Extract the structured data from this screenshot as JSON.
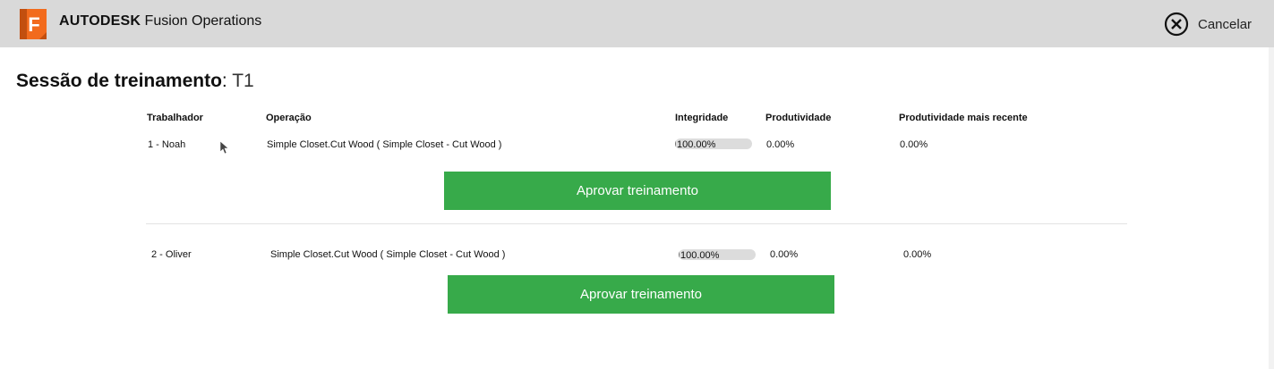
{
  "header": {
    "brand_bold": "AUTODESK",
    "brand_rest": " Fusion Operations",
    "logo_letter": "F",
    "cancel_label": "Cancelar",
    "logo_color": "#f26b1d"
  },
  "page": {
    "title_label": "Sessão de treinamento",
    "title_colon": ":",
    "title_value": " T1"
  },
  "columns": {
    "worker": "Trabalhador",
    "operation": "Operação",
    "integrity": "Integridade",
    "productivity": "Produtividade",
    "recent_productivity": "Produtividade mais recente"
  },
  "rows": [
    {
      "worker": "1 - Noah",
      "operation": "Simple Closet.Cut Wood ( Simple Closet - Cut Wood )",
      "integrity_text": "100.00%",
      "integrity_value": 1.0,
      "productivity": "0.00%",
      "recent_productivity": "0.00%",
      "approve_label": "Aprovar treinamento"
    },
    {
      "worker": "2 - Oliver",
      "operation": "Simple Closet.Cut Wood ( Simple Closet - Cut Wood )",
      "integrity_text": "100.00%",
      "integrity_value": 1.0,
      "productivity": "0.00%",
      "recent_productivity": "0.00%",
      "approve_label": "Aprovar treinamento"
    }
  ],
  "colors": {
    "approve_button": "#37aa4a",
    "header_bg": "#d9d9d9"
  }
}
